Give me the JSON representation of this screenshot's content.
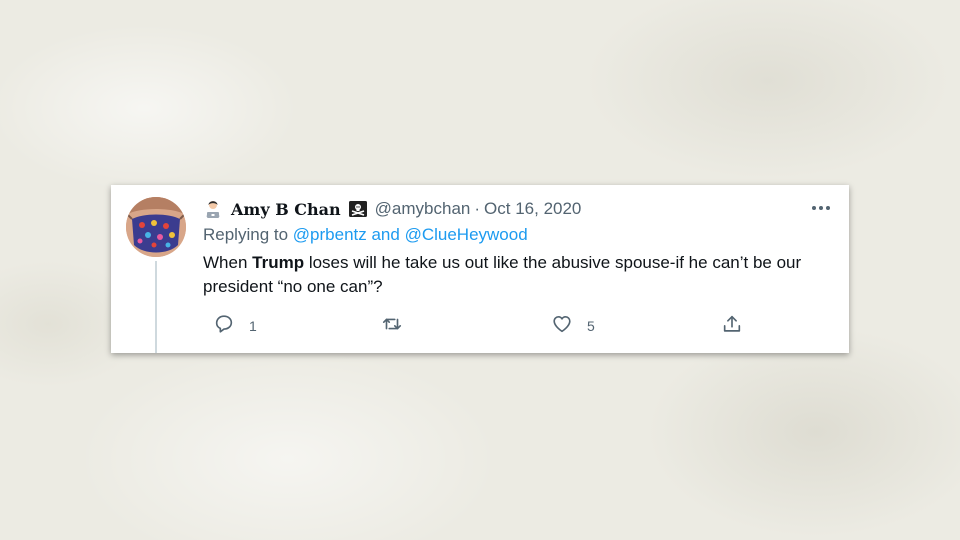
{
  "tweet": {
    "author_name": "Amy B Chan",
    "handle": "@amybchan",
    "separator": "·",
    "date": "Oct 16, 2020",
    "reply_prefix": "Replying to",
    "reply_mentions": "@prbentz and @ClueHeywood",
    "text_before": "When ",
    "text_bold": "Trump",
    "text_after": " loses will he take us out like the abusive spouse-if he can’t be our president “no one can”?",
    "reply_count": "1",
    "retweet_count": "",
    "like_count": "5"
  },
  "icons": {
    "author_emoji": "woman-technologist-emoji",
    "name_flag": "pirate-flag-emoji",
    "more": "more-horizontal-icon",
    "reply": "reply-icon",
    "retweet": "retweet-icon",
    "like": "heart-icon",
    "share": "share-icon"
  },
  "colors": {
    "text": "#0f1419",
    "secondary": "#536471",
    "link": "#1d9bf0",
    "background": "#ecebe3"
  }
}
